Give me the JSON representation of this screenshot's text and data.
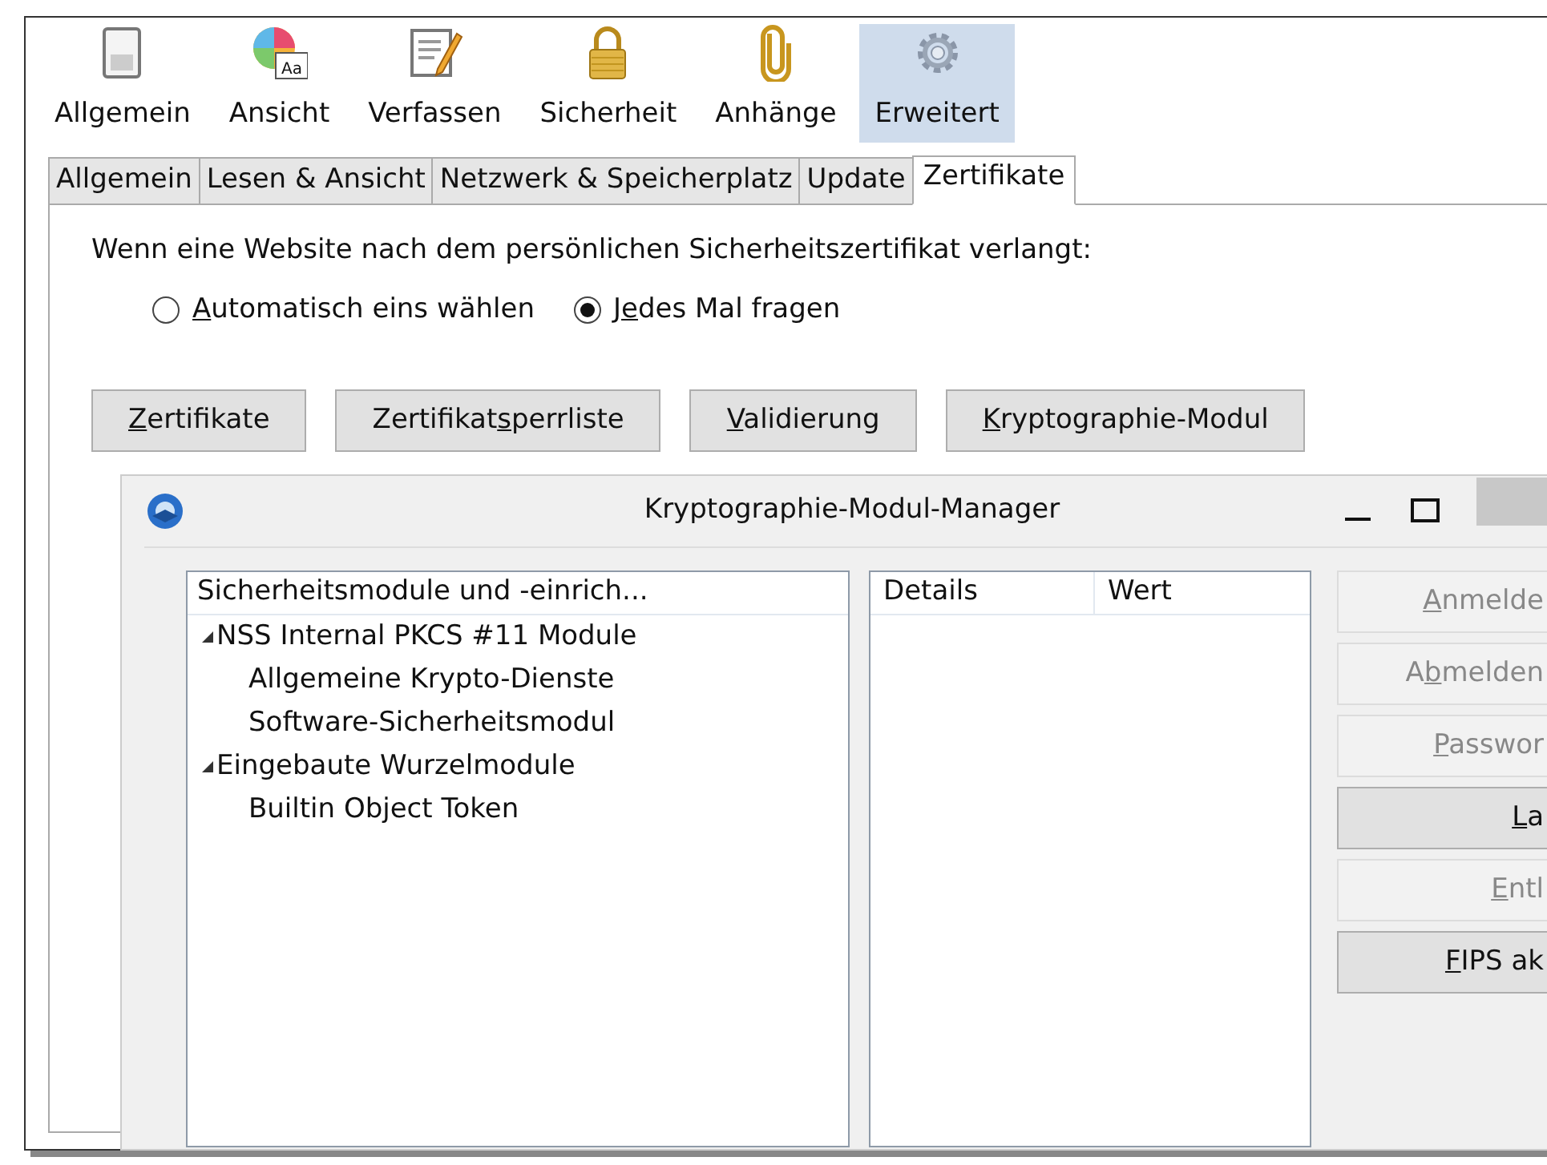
{
  "toolbar": [
    {
      "label": "Allgemein",
      "selected": false
    },
    {
      "label": "Ansicht",
      "selected": false,
      "icon_text": "Aa"
    },
    {
      "label": "Verfassen",
      "selected": false
    },
    {
      "label": "Sicherheit",
      "selected": false
    },
    {
      "label": "Anhänge",
      "selected": false
    },
    {
      "label": "Erweitert",
      "selected": true
    }
  ],
  "tabs": [
    {
      "label": "Allgemein",
      "selected": false
    },
    {
      "label": "Lesen & Ansicht",
      "selected": false
    },
    {
      "label": "Netzwerk & Speicherplatz",
      "selected": false
    },
    {
      "label": "Update",
      "selected": false
    },
    {
      "label": "Zertifikate",
      "selected": true
    }
  ],
  "prompt": "Wenn eine Website nach dem persönlichen Sicherheitszertifikat verlangt:",
  "radios": [
    {
      "key": "A",
      "post": "utomatisch eins wählen",
      "selected": false
    },
    {
      "pre": "J",
      "key": "e",
      "post": "des Mal fragen",
      "selected": true
    }
  ],
  "buttons": [
    {
      "key": "Z",
      "post": "ertifikate"
    },
    {
      "pre": "Zertifikat",
      "key": "s",
      "post": "perrliste"
    },
    {
      "key": "V",
      "post": "alidierung"
    },
    {
      "key": "K",
      "post": "ryptographie-Modul"
    }
  ],
  "dialog": {
    "title": "Kryptographie-Modul-Manager",
    "modules": {
      "column": "Sicherheitsmodule und -einrich...",
      "items": [
        {
          "label": "NSS Internal PKCS #11 Module",
          "expanded": true,
          "children": [
            {
              "label": "Allgemeine Krypto-Dienste"
            },
            {
              "label": "Software-Sicherheitsmodul"
            }
          ]
        },
        {
          "label": "Eingebaute Wurzelmodule",
          "expanded": true,
          "children": [
            {
              "label": "Builtin Object Token"
            }
          ]
        }
      ]
    },
    "details": {
      "columns": [
        "Details",
        "Wert"
      ]
    },
    "buttons": [
      {
        "key": "A",
        "post": "nmelde",
        "disabled": true
      },
      {
        "pre": "A",
        "key": "b",
        "post": "melden",
        "disabled": true
      },
      {
        "key": "P",
        "post": "asswor",
        "disabled": true
      },
      {
        "key": "L",
        "post": "a",
        "disabled": false
      },
      {
        "key": "E",
        "post": "ntl",
        "disabled": true
      },
      {
        "key": "F",
        "post": "IPS ak",
        "disabled": false
      }
    ]
  }
}
